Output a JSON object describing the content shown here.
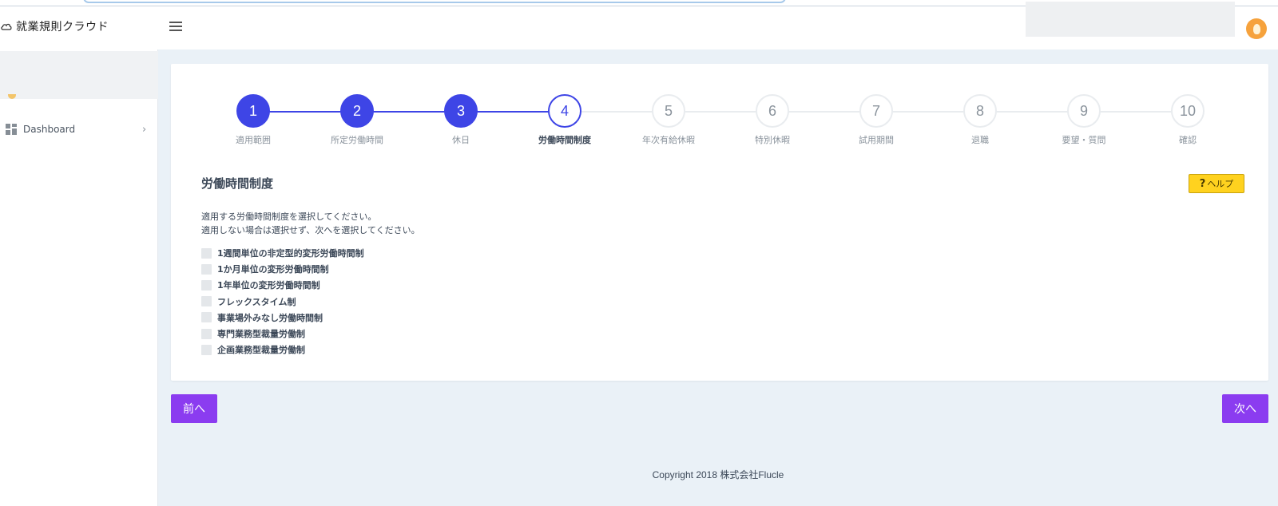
{
  "app": {
    "title": "就業規則クラウド"
  },
  "header": {
    "menu_icon": "hamburger-icon",
    "avatar_icon": "user-avatar-icon"
  },
  "sidebar": {
    "items": [
      {
        "label": "Dashboard",
        "icon": "grid-icon"
      }
    ]
  },
  "stepper": {
    "current": 4,
    "accent_color": "#3e45e6",
    "steps": [
      {
        "number": "1",
        "label": "適用範囲",
        "state": "done"
      },
      {
        "number": "2",
        "label": "所定労働時間",
        "state": "done"
      },
      {
        "number": "3",
        "label": "休日",
        "state": "done"
      },
      {
        "number": "4",
        "label": "労働時間制度",
        "state": "active"
      },
      {
        "number": "5",
        "label": "年次有給休暇",
        "state": "todo"
      },
      {
        "number": "6",
        "label": "特別休暇",
        "state": "todo"
      },
      {
        "number": "7",
        "label": "試用期間",
        "state": "todo"
      },
      {
        "number": "8",
        "label": "退職",
        "state": "todo"
      },
      {
        "number": "9",
        "label": "要望・質問",
        "state": "todo"
      },
      {
        "number": "10",
        "label": "確認",
        "state": "todo"
      }
    ]
  },
  "section": {
    "title": "労働時間制度",
    "help_label": "ヘルプ",
    "help_icon": "question-icon",
    "description_line1": "適用する労働時間制度を選択してください。",
    "description_line2": "適用しない場合は選択せず、次へを選択してください。"
  },
  "options": [
    {
      "label": "1週間単位の非定型的変形労働時間制",
      "checked": false
    },
    {
      "label": "1か月単位の変形労働時間制",
      "checked": false
    },
    {
      "label": "1年単位の変形労働時間制",
      "checked": false
    },
    {
      "label": "フレックスタイム制",
      "checked": false
    },
    {
      "label": "事業場外みなし労働時間制",
      "checked": false
    },
    {
      "label": "専門業務型裁量労働制",
      "checked": false
    },
    {
      "label": "企画業務型裁量労働制",
      "checked": false
    }
  ],
  "buttons": {
    "prev": "前へ",
    "next": "次へ",
    "color": "#8b3cf0"
  },
  "footer": {
    "copyright": "Copyright 2018 株式会社Flucle"
  }
}
